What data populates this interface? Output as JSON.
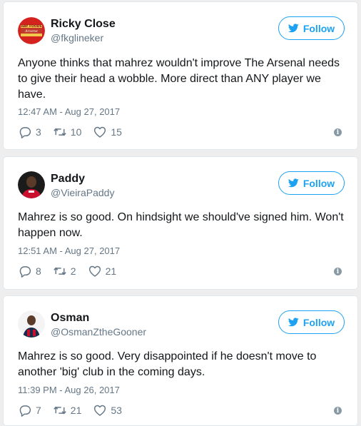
{
  "follow_label": "Follow",
  "colors": {
    "accent": "#1da1f2",
    "text": "#14171a",
    "muted": "#657786"
  },
  "tweets": [
    {
      "name": "Ricky Close",
      "handle": "@fkglineker",
      "avatar_logo_text": "HAY FOODS ARSENE",
      "text": "Anyone thinks that mahrez wouldn't improve The Arsenal needs to give their head a wobble. More direct than ANY player we have.",
      "timestamp": "12:47 AM - Aug 27, 2017",
      "replies": "3",
      "retweets": "10",
      "likes": "15"
    },
    {
      "name": "Paddy",
      "handle": "@VieiraPaddy",
      "text": "Mahrez is so good. On hindsight we should've signed him. Won't happen now.",
      "timestamp": "12:51 AM - Aug 27, 2017",
      "replies": "8",
      "retweets": "2",
      "likes": "21"
    },
    {
      "name": "Osman",
      "handle": "@OsmanZtheGooner",
      "text": "Mahrez is so good. Very disappointed if he doesn't move to another 'big' club in the coming days.",
      "timestamp": "11:39 PM - Aug 26, 2017",
      "replies": "7",
      "retweets": "21",
      "likes": "53"
    }
  ]
}
